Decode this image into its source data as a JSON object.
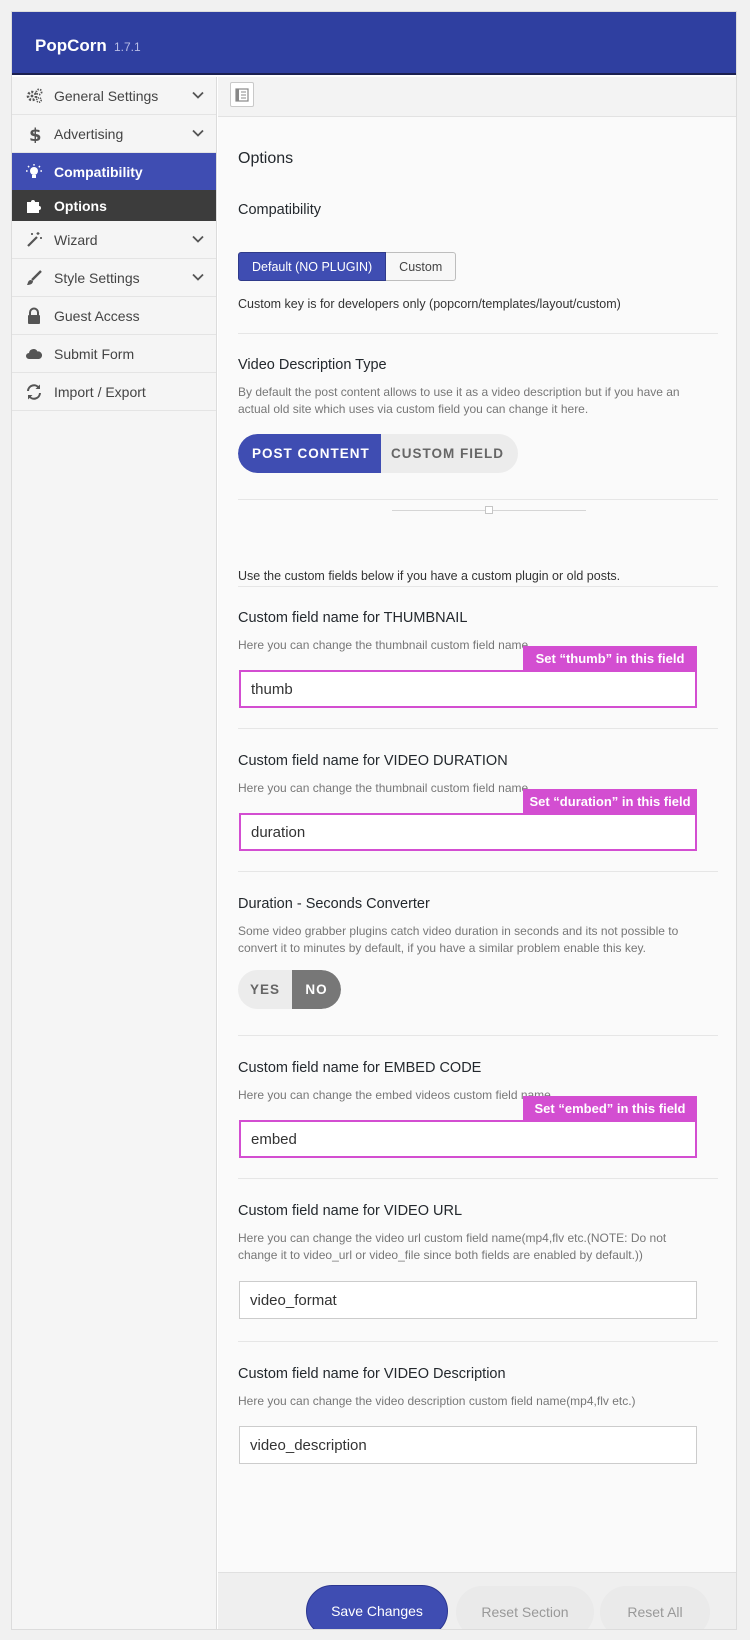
{
  "app": {
    "name": "PopCorn",
    "version": "1.7.1"
  },
  "sidebar": {
    "items": [
      {
        "label": "General Settings",
        "icon": "gears-icon",
        "has_children": true
      },
      {
        "label": "Advertising",
        "icon": "dollar-icon",
        "has_children": true
      },
      {
        "label": "Compatibility",
        "icon": "lightbulb-icon",
        "active": true
      },
      {
        "label": "Options",
        "icon": "puzzle-icon",
        "sub": true
      },
      {
        "label": "Wizard",
        "icon": "magic-wand-icon",
        "has_children": true
      },
      {
        "label": "Style Settings",
        "icon": "brush-icon",
        "has_children": true
      },
      {
        "label": "Guest Access",
        "icon": "lock-icon"
      },
      {
        "label": "Submit Form",
        "icon": "cloud-icon"
      },
      {
        "label": "Import / Export",
        "icon": "refresh-icon"
      }
    ]
  },
  "main": {
    "title": "Options",
    "compat": {
      "title": "Compatibility",
      "btn_default": "Default (NO PLUGIN)",
      "btn_custom": "Custom",
      "selected": "Default (NO PLUGIN)",
      "note": "Custom key is for developers only (popcorn/templates/layout/custom)"
    },
    "video_desc_type": {
      "title": "Video Description Type",
      "desc1": "By default the post content allows to use it as a video description but if you have an",
      "desc2": "actual old site which uses via custom field you can change it here.",
      "opt_post": "POST CONTENT",
      "opt_custom": "CUSTOM FIELD",
      "selected": "POST CONTENT"
    },
    "custom_note": "Use the custom fields below if you have a custom plugin or old posts.",
    "thumbnail": {
      "title": "Custom field name for THUMBNAIL",
      "desc": "Here you can change the thumbnail custom field name.",
      "value": "thumb",
      "tag": "Set “thumb” in this field"
    },
    "duration": {
      "title": "Custom field name for VIDEO DURATION",
      "desc": "Here you can change the thumbnail custom field name.",
      "value": "duration",
      "tag": "Set “duration” in this field"
    },
    "converter": {
      "title": "Duration - Seconds Converter",
      "desc1": "Some video grabber plugins catch video duration in seconds and its not possible to",
      "desc2": "convert it to minutes by default, if you have a similar problem enable this key.",
      "yes": "YES",
      "no": "NO",
      "selected": "NO"
    },
    "embed": {
      "title": "Custom field name for EMBED CODE",
      "desc": "Here you can change the embed videos custom field name.",
      "value": "embed",
      "tag": "Set “embed” in this field"
    },
    "video_url": {
      "title": "Custom field name for VIDEO URL",
      "desc1": "Here you can change the video url custom field name(mp4,flv etc.(NOTE: Do not",
      "desc2": "change it to video_url or video_file since both fields are enabled by default.))",
      "value": "video_format"
    },
    "video_description": {
      "title": "Custom field name for VIDEO Description",
      "desc": "Here you can change the video description custom field name(mp4,flv etc.)",
      "value": "video_description"
    }
  },
  "footer": {
    "save": "Save Changes",
    "reset_section": "Reset Section",
    "reset_all": "Reset All"
  },
  "colors": {
    "brand": "#2f3fa0",
    "accent": "#3f4db2",
    "highlight": "#d34ed1"
  }
}
